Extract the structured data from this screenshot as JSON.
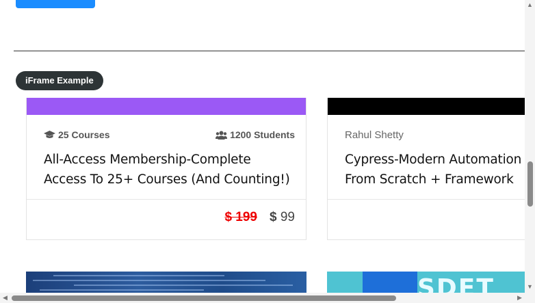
{
  "section_badge": "iFrame Example",
  "cards": [
    {
      "banner_color": "#9b59f5",
      "courses_count": "25 Courses",
      "students_count": "1200 Students",
      "title_line1": "All-Access Membership-Complete",
      "title_line2": "Access To 25+ Courses (And Counting!)",
      "old_price": "$ 199",
      "new_price_currency": "$",
      "new_price_value": "99"
    },
    {
      "banner_color": "#000000",
      "author": "Rahul Shetty",
      "title_line1": "Cypress-Modern Automation",
      "title_line2": "From Scratch + Framework"
    }
  ],
  "thumbnails": [
    {
      "name": "code-thumbnail"
    },
    {
      "name": "sdet-thumbnail",
      "text": "SDET"
    }
  ],
  "colors": {
    "accent": "#1a8cff",
    "badge_bg": "#2d3436",
    "old_price": "#ee0000"
  }
}
